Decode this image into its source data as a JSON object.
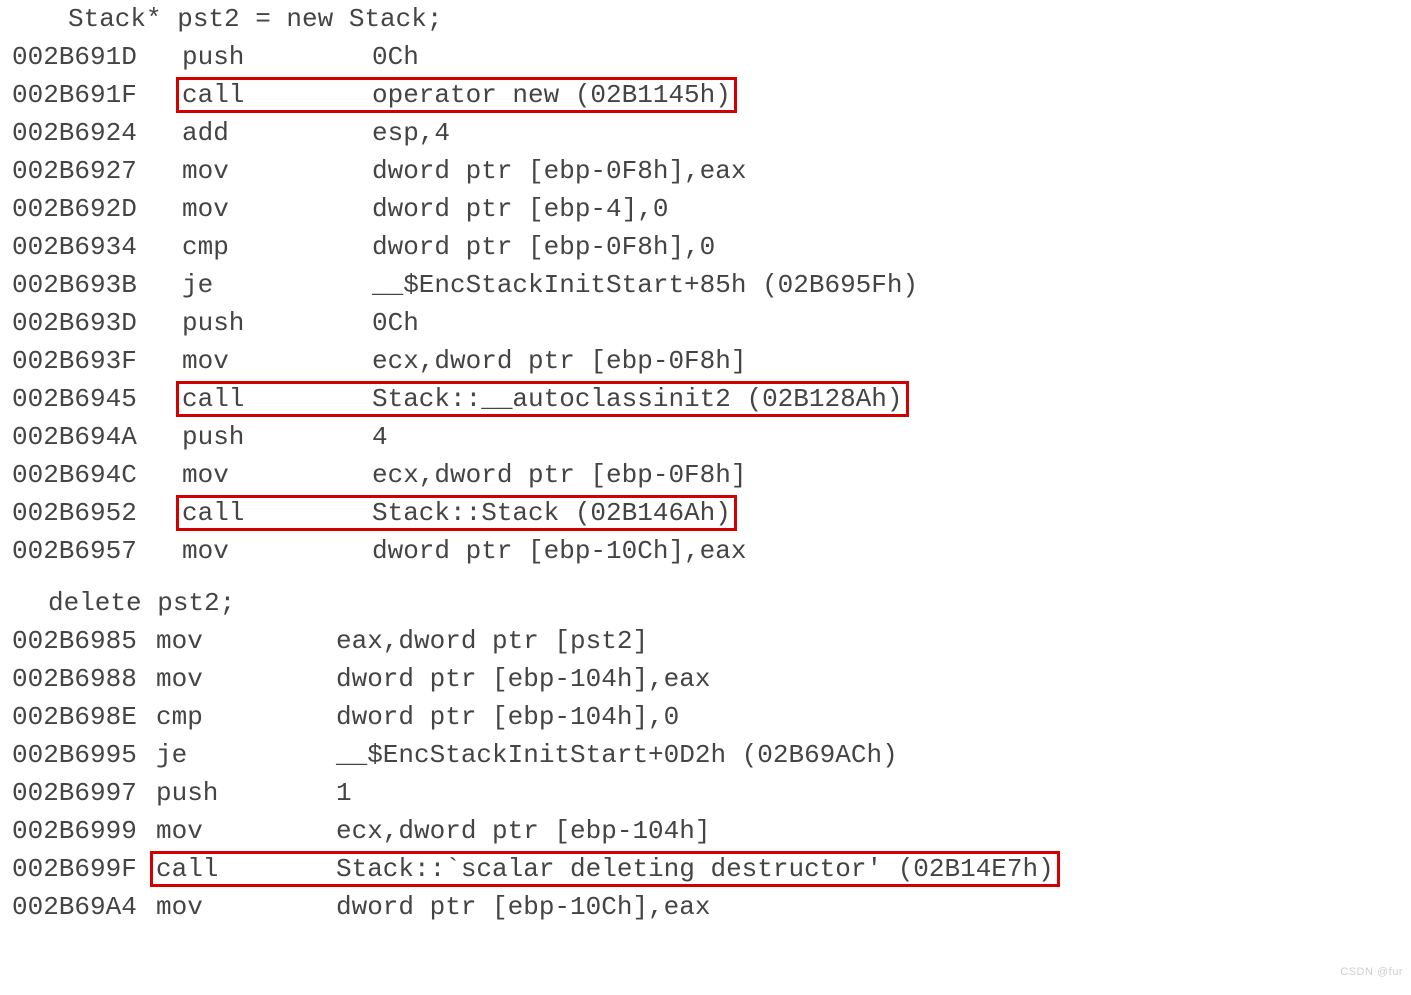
{
  "src1": "Stack* pst2 = new Stack;",
  "src2": "delete pst2;",
  "b1": [
    {
      "a": "002B691D",
      "m": "push",
      "o": "0Ch",
      "h": 0
    },
    {
      "a": "002B691F",
      "m": "call",
      "o": "operator new (02B1145h)",
      "h": 1
    },
    {
      "a": "002B6924",
      "m": "add",
      "o": "esp,4",
      "h": 0
    },
    {
      "a": "002B6927",
      "m": "mov",
      "o": "dword ptr [ebp-0F8h],eax",
      "h": 0
    },
    {
      "a": "002B692D",
      "m": "mov",
      "o": "dword ptr [ebp-4],0",
      "h": 0
    },
    {
      "a": "002B6934",
      "m": "cmp",
      "o": "dword ptr [ebp-0F8h],0",
      "h": 0
    },
    {
      "a": "002B693B",
      "m": "je",
      "o": "__$EncStackInitStart+85h (02B695Fh)",
      "h": 0
    },
    {
      "a": "002B693D",
      "m": "push",
      "o": "0Ch",
      "h": 0
    },
    {
      "a": "002B693F",
      "m": "mov",
      "o": "ecx,dword ptr [ebp-0F8h]",
      "h": 0
    },
    {
      "a": "002B6945",
      "m": "call",
      "o": "Stack::__autoclassinit2 (02B128Ah)",
      "h": 1
    },
    {
      "a": "002B694A",
      "m": "push",
      "o": "4",
      "h": 0
    },
    {
      "a": "002B694C",
      "m": "mov",
      "o": "ecx,dword ptr [ebp-0F8h]",
      "h": 0
    },
    {
      "a": "002B6952",
      "m": "call",
      "o": "Stack::Stack (02B146Ah)",
      "h": 1
    },
    {
      "a": "002B6957",
      "m": "mov",
      "o": "dword ptr [ebp-10Ch],eax",
      "h": 0
    }
  ],
  "b2": [
    {
      "a": "002B6985",
      "m": "mov",
      "o": "eax,dword ptr [pst2]",
      "h": 0
    },
    {
      "a": "002B6988",
      "m": "mov",
      "o": "dword ptr [ebp-104h],eax",
      "h": 0
    },
    {
      "a": "002B698E",
      "m": "cmp",
      "o": "dword ptr [ebp-104h],0",
      "h": 0
    },
    {
      "a": "002B6995",
      "m": "je",
      "o": "__$EncStackInitStart+0D2h (02B69ACh)",
      "h": 0
    },
    {
      "a": "002B6997",
      "m": "push",
      "o": "1",
      "h": 0
    },
    {
      "a": "002B6999",
      "m": "mov",
      "o": "ecx,dword ptr [ebp-104h]",
      "h": 0
    },
    {
      "a": "002B699F",
      "m": "call",
      "o": "Stack::`scalar deleting destructor' (02B14E7h)",
      "h": 1
    },
    {
      "a": "002B69A4",
      "m": "mov",
      "o": "dword ptr [ebp-10Ch],eax",
      "h": 0
    }
  ],
  "watermark": "CSDN @fur"
}
